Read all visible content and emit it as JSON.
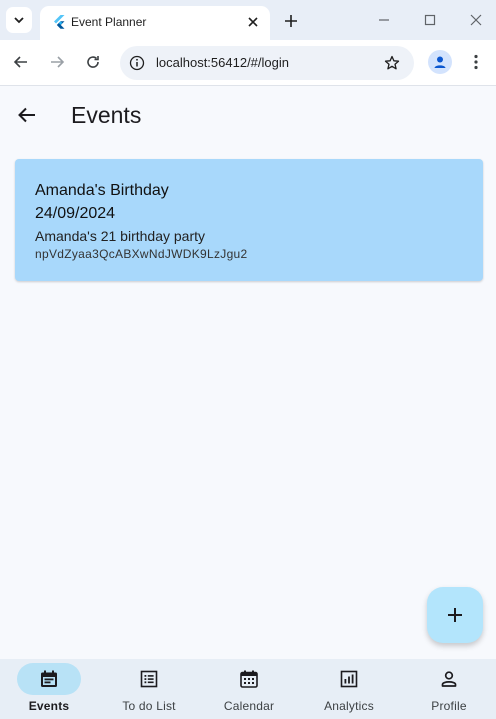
{
  "browser": {
    "tab_title": "Event Planner",
    "url": "localhost:56412/#/login"
  },
  "appbar": {
    "title": "Events"
  },
  "events": [
    {
      "title": "Amanda's Birthday",
      "date": "24/09/2024",
      "description": "Amanda's 21 birthday party",
      "id": "npVdZyaa3QcABXwNdJWDK9LzJgu2"
    }
  ],
  "bottom_nav": {
    "items": [
      {
        "label": "Events",
        "icon": "event-icon",
        "active": true
      },
      {
        "label": "To do List",
        "icon": "checklist-icon",
        "active": false
      },
      {
        "label": "Calendar",
        "icon": "calendar-icon",
        "active": false
      },
      {
        "label": "Analytics",
        "icon": "analytics-icon",
        "active": false
      },
      {
        "label": "Profile",
        "icon": "person-icon",
        "active": false
      }
    ]
  },
  "colors": {
    "card_background": "#a8d8fb",
    "fab_background": "#b3e5fc",
    "active_nav_indicator": "#b8e2f6",
    "nav_background": "#e7eef6",
    "page_background": "#f7f9fd"
  }
}
